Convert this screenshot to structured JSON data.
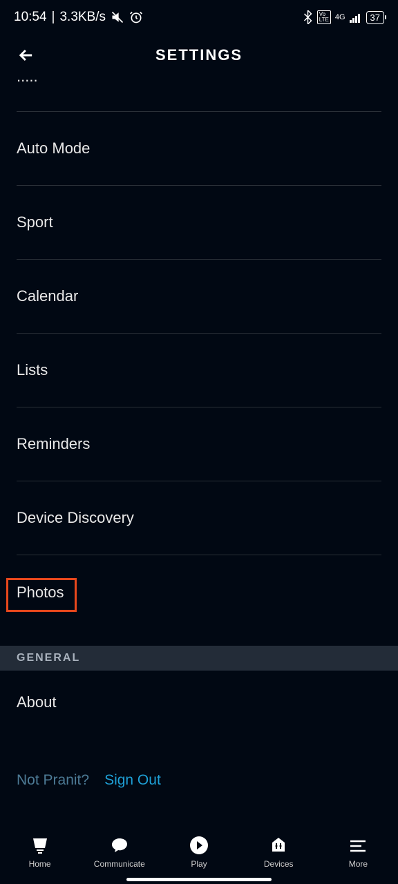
{
  "status_bar": {
    "time": "10:54",
    "speed": "3.3KB/s",
    "network_4g": "4G",
    "battery_pct": "37"
  },
  "header": {
    "title": "SETTINGS"
  },
  "settings_items": {
    "partial": "...",
    "auto_mode": "Auto Mode",
    "sport": "Sport",
    "calendar": "Calendar",
    "lists": "Lists",
    "reminders": "Reminders",
    "device_discovery": "Device Discovery",
    "photos": "Photos"
  },
  "section": {
    "general": "GENERAL"
  },
  "general_items": {
    "about": "About"
  },
  "auth": {
    "not_user": "Not Pranit?",
    "sign_out": "Sign Out"
  },
  "nav": {
    "home": "Home",
    "communicate": "Communicate",
    "play": "Play",
    "devices": "Devices",
    "more": "More"
  }
}
